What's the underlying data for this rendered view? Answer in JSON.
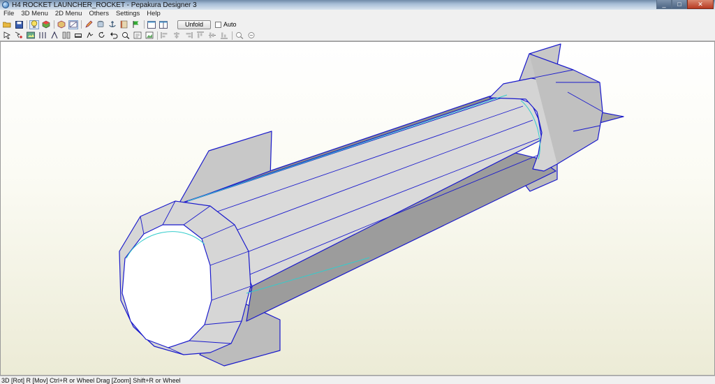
{
  "window": {
    "title": "H4 ROCKET LAUNCHER_ROCKET - Pepakura Designer 3",
    "minimize": "_",
    "maximize": "□",
    "close": "✕"
  },
  "menu": [
    "File",
    "3D Menu",
    "2D Menu",
    "Others",
    "Settings",
    "Help"
  ],
  "toolbar": {
    "unfold_label": "Unfold",
    "auto_label": "Auto",
    "auto_checked": false
  },
  "status": {
    "text": "3D [Rot] R [Mov] Ctrl+R or Wheel Drag [Zoom] Shift+R or Wheel"
  },
  "colors": {
    "edge": "#1a1acc",
    "face": "#c8c8c8",
    "face_light": "#e4e4e4",
    "face_dark": "#9a9a9a",
    "fold_line": "#33cccc"
  }
}
